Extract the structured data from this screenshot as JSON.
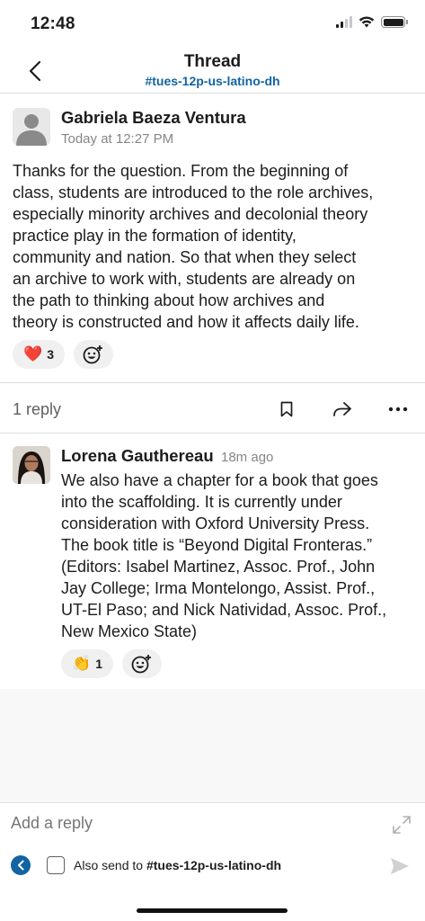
{
  "status_bar": {
    "time": "12:48"
  },
  "header": {
    "title": "Thread",
    "channel": "#tues-12p-us-latino-dh"
  },
  "post": {
    "author": "Gabriela Baeza Ventura",
    "timestamp": "Today at 12:27 PM",
    "lines": [
      "Thanks for the question. From the beginning of",
      "class, students are introduced to the role archives,",
      "especially minority archives and decolonial theory",
      "practice play in the formation of identity,",
      "community and nation. So that when they select",
      "an archive to work with, students are already on",
      "the path to thinking about how archives and",
      "theory is constructed and how it affects daily life."
    ],
    "reaction": {
      "emoji": "❤️",
      "count": "3"
    }
  },
  "thread_actions": {
    "reply_count": "1 reply",
    "icons": [
      "bookmark-icon",
      "share-icon",
      "more-icon"
    ]
  },
  "reply": {
    "author": "Lorena Gauthereau",
    "timestamp": "18m ago",
    "lines": [
      "We also have a chapter for a book that goes",
      "into the scaffolding. It is currently under",
      "consideration with Oxford University Press.",
      "The book title is “Beyond Digital Fronteras.”",
      "(Editors: Isabel Martinez, Assoc. Prof., John",
      "Jay College; Irma Montelongo, Assist. Prof.,",
      "UT-El Paso; and Nick Natividad, Assoc. Prof.,",
      "New Mexico State)"
    ],
    "reaction": {
      "emoji": "👏",
      "count": "1"
    }
  },
  "composer": {
    "placeholder": "Add a reply",
    "also_send_prefix": "Also send to ",
    "also_send_channel": "#tues-12p-us-latino-dh"
  },
  "colors": {
    "link": "#1264a3",
    "text": "#1d1c1d",
    "muted": "#868686",
    "divider": "#dedede"
  }
}
